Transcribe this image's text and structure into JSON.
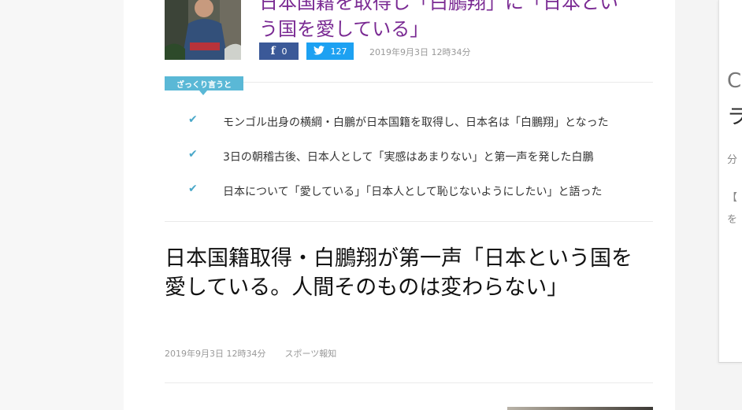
{
  "related": {
    "title_line1": "日本国籍を取得し「白鵬翔」に「日本とい",
    "title_line2": "う国を愛している」",
    "facebook_count": "0",
    "twitter_count": "127",
    "date": "2019年9月3日 12時34分"
  },
  "summary": {
    "badge": "ざっくり言うと",
    "items": [
      "モンゴル出身の横綱・白鵬が日本国籍を取得し、日本名は「白鵬翔」となった",
      "3日の朝稽古後、日本人として「実感はあまりない」と第一声を発した白鵬",
      "日本について「愛している」「日本人として恥じないようにしたい」と語った"
    ]
  },
  "article": {
    "title": "日本国籍取得・白鵬翔が第一声「日本という国を愛している。人間そのものは変わらない」",
    "date": "2019年9月3日 12時34分",
    "source": "スポーツ報知"
  },
  "side_widget": {
    "glyphs": [
      "C",
      "ラ",
      "分",
      "【",
      "を"
    ]
  },
  "colors": {
    "related_title": "#7a2a93",
    "facebook": "#3b5998",
    "twitter": "#1da1f2",
    "badge": "#5ab8d6",
    "check": "#4aa8c9"
  },
  "icons": {
    "facebook": "facebook-icon",
    "twitter": "twitter-icon",
    "check": "check-icon"
  }
}
